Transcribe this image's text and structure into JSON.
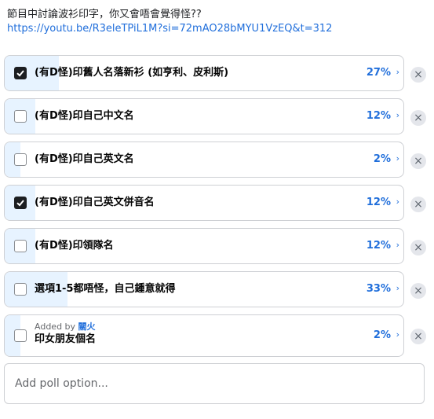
{
  "question": {
    "text": "節目中討論波衫印字，你又會唔會覺得怪??",
    "link": "https://youtu.be/R3eleTPiL1M?si=72mAO28bMYU1VzEQ&t=312"
  },
  "options": [
    {
      "label": "(有D怪)印舊人名落新衫 (如亨利、皮利斯)",
      "percent_text": "27%",
      "percent": 27,
      "checked": true
    },
    {
      "label": "(有D怪)印自己中文名",
      "percent_text": "12%",
      "percent": 12,
      "checked": false
    },
    {
      "label": "(有D怪)印自己英文名",
      "percent_text": "2%",
      "percent": 2,
      "checked": false
    },
    {
      "label": "(有D怪)印自己英文併音名",
      "percent_text": "12%",
      "percent": 12,
      "checked": true
    },
    {
      "label": "(有D怪)印領隊名",
      "percent_text": "12%",
      "percent": 12,
      "checked": false
    },
    {
      "label": "選項1-5都唔怪，自己鍾意就得",
      "percent_text": "33%",
      "percent": 33,
      "checked": false
    },
    {
      "added_prefix": "Added by",
      "added_by": "關火",
      "label": "印女朋友個名",
      "percent_text": "2%",
      "percent": 2,
      "checked": false
    }
  ],
  "chevron": "›",
  "remove_symbol": "×",
  "add_option": {
    "placeholder": "Add poll option..."
  },
  "colors": {
    "accent": "#216fdb",
    "fill": "#e7f3ff",
    "border": "#ced0d4"
  }
}
